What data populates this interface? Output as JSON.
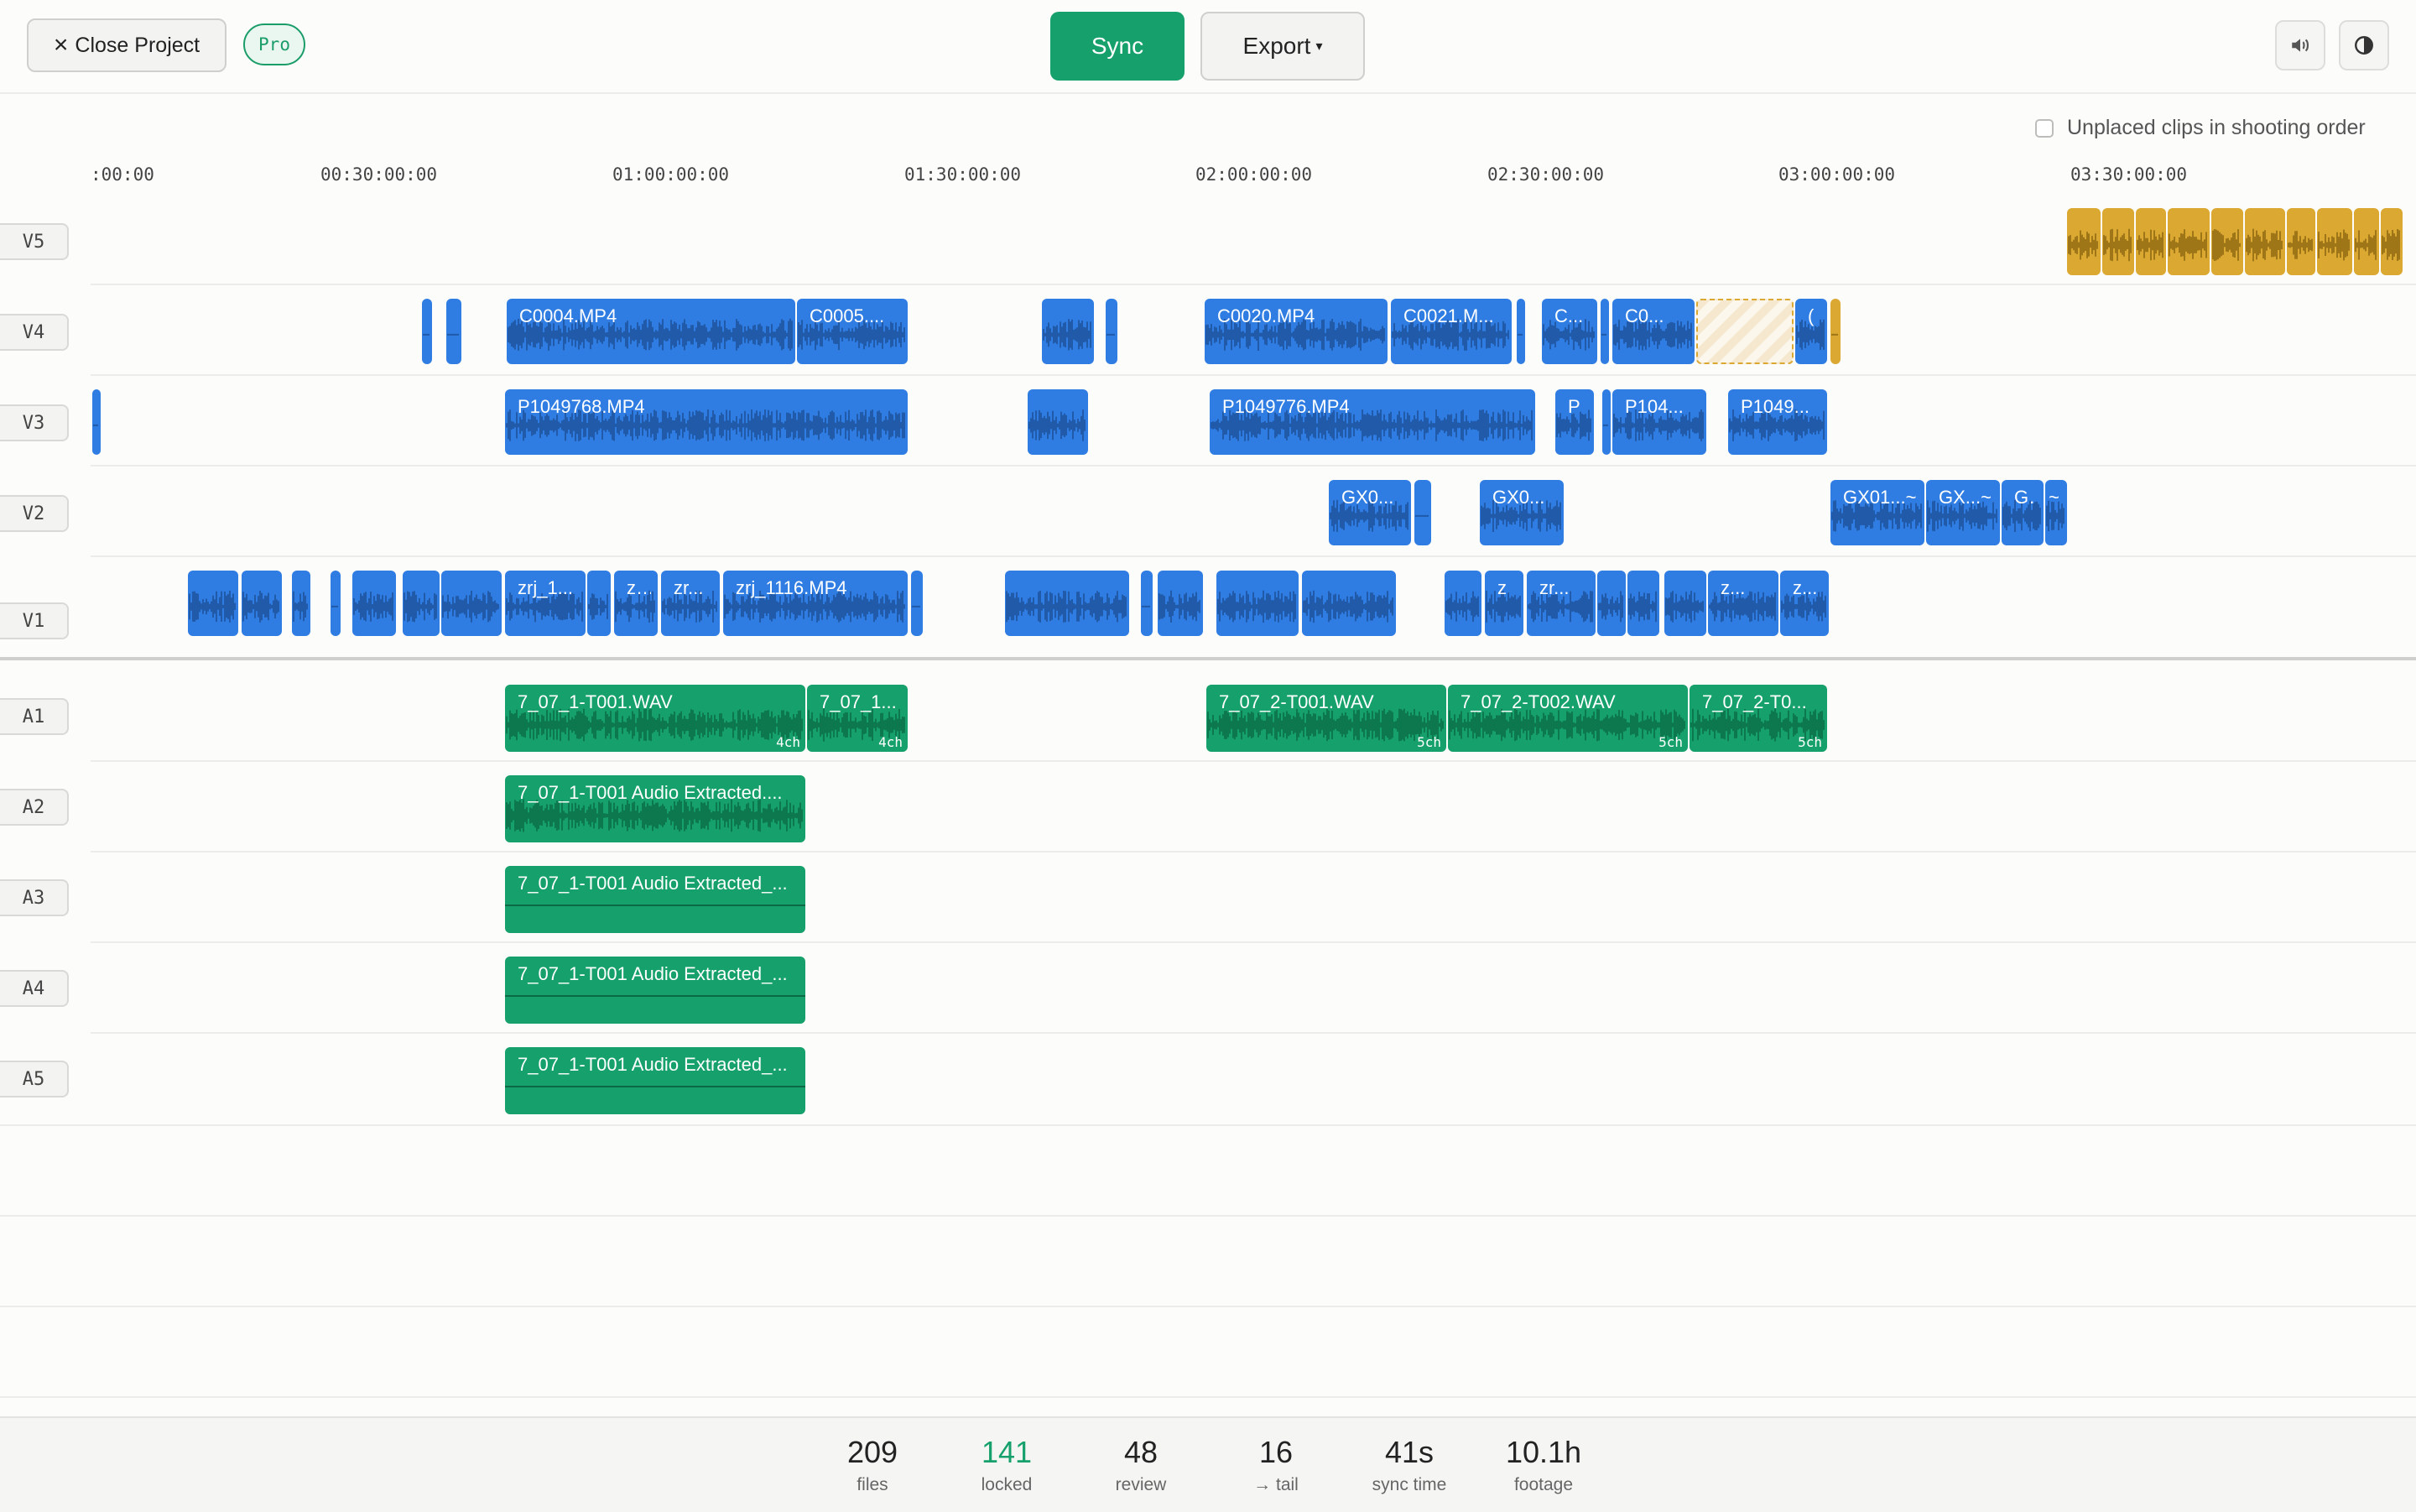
{
  "toolbar": {
    "close_label": "Close Project",
    "pro_badge": "Pro",
    "sync_label": "Sync",
    "export_label": "Export",
    "volume_icon": "speaker-icon",
    "theme_icon": "contrast-icon"
  },
  "unplaced_label": "Unplaced clips in shooting order",
  "ruler": [
    ":00:00",
    "00:30:00:00",
    "01:00:00:00",
    "01:30:00:00",
    "02:00:00:00",
    "02:30:00:00",
    "03:00:00:00",
    "03:30:00:00"
  ],
  "tracks": {
    "video": [
      "V5",
      "V4",
      "V3",
      "V2",
      "V1"
    ],
    "audio": [
      "A1",
      "A2",
      "A3",
      "A4",
      "A5"
    ]
  },
  "clips": {
    "v4": [
      "C0004.MP4",
      "C0005....",
      "C0020.MP4",
      "C0021.M...",
      "C...",
      "C0...",
      "("
    ],
    "v3": [
      "P1049768.MP4",
      "P1049776.MP4",
      "P",
      "P104...",
      "P1049..."
    ],
    "v2": [
      "GX0...",
      "GX0...",
      "GX01...~",
      "GX...~",
      "G..",
      "~"
    ],
    "v1": [
      "zrj_1...",
      "z...",
      "zr...",
      "zrj_1116.MP4",
      "z",
      "zr...",
      "z...",
      "z..."
    ],
    "a1": [
      {
        "name": "7_07_1-T001.WAV",
        "channels": "4ch"
      },
      {
        "name": "7_07_1...",
        "channels": "4ch"
      },
      {
        "name": "7_07_2-T001.WAV",
        "channels": "5ch"
      },
      {
        "name": "7_07_2-T002.WAV",
        "channels": "5ch"
      },
      {
        "name": "7_07_2-T0...",
        "channels": "5ch"
      }
    ],
    "a2": [
      "7_07_1-T001 Audio Extracted...."
    ],
    "a3": [
      "7_07_1-T001 Audio Extracted_..."
    ],
    "a4": [
      "7_07_1-T001 Audio Extracted_..."
    ],
    "a5": [
      "7_07_1-T001 Audio Extracted_..."
    ]
  },
  "stats": [
    {
      "value": "209",
      "label": "files",
      "color": "#222222"
    },
    {
      "value": "141",
      "label": "locked",
      "color": "#16a06b"
    },
    {
      "value": "48",
      "label": "review",
      "color": "#222222"
    },
    {
      "value": "16",
      "label": "→ tail",
      "color": "#222222"
    },
    {
      "value": "41s",
      "label": "sync time",
      "color": "#222222"
    },
    {
      "value": "10.1h",
      "label": "footage",
      "color": "#222222"
    }
  ],
  "colors": {
    "video_clip": "#2f7de2",
    "audio_clip": "#16a06b",
    "unplaced_clip": "#dba832"
  }
}
